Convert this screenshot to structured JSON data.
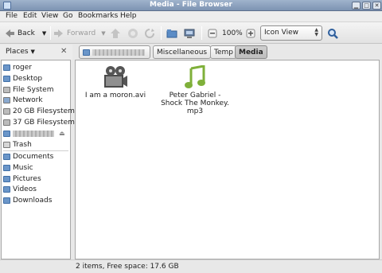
{
  "window": {
    "title": "Media - File Browser"
  },
  "menu": [
    "File",
    "Edit",
    "View",
    "Go",
    "Bookmarks",
    "Help"
  ],
  "toolbar": {
    "back_label": "Back",
    "forward_label": "Forward",
    "zoom_level": "100%",
    "view_mode": "Icon View"
  },
  "sidebar": {
    "places_label": "Places",
    "items": [
      "roger",
      "Desktop",
      "File System",
      "Network",
      "20 GB Filesystem",
      "37 GB Filesystem",
      "Trash",
      "Documents",
      "Music",
      "Pictures",
      "Videos",
      "Downloads"
    ]
  },
  "pathbar": {
    "crumbs": [
      "Miscellaneous",
      "Temp",
      "Media"
    ]
  },
  "files": [
    {
      "name": "I am a moron.avi",
      "icon": "video-file-icon"
    },
    {
      "name": "Peter Gabriel - Shock The Monkey.mp3",
      "name_lines": [
        "Peter Gabriel -",
        "Shock The Monkey.",
        "mp3"
      ],
      "icon": "music-file-icon"
    }
  ],
  "status": {
    "text": "2 items, Free space: 17.6 GB"
  },
  "colors": {
    "accent": "#3f6ea6",
    "titlebar": "#8ea3c1"
  }
}
